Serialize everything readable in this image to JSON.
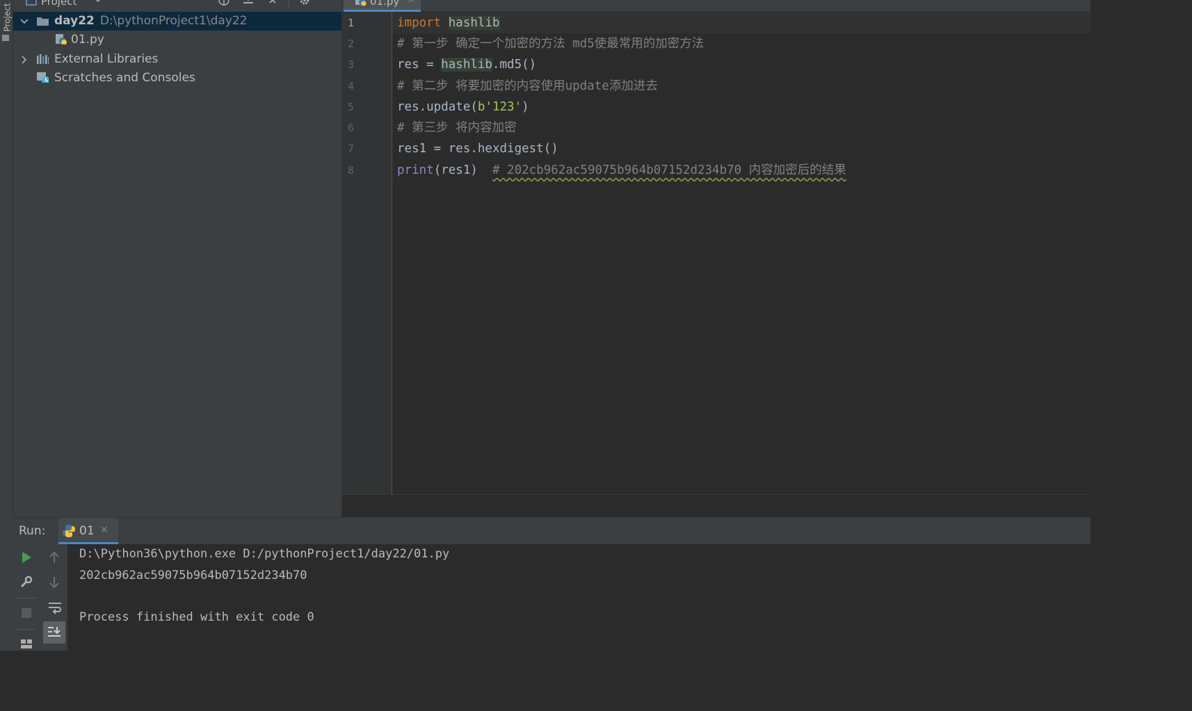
{
  "left_strip": {
    "label": "Project"
  },
  "project_panel": {
    "title": "Project",
    "tree": [
      {
        "label": "day22",
        "path": "D:\\pythonProject1\\day22",
        "expanded": true,
        "selected": true,
        "icon": "folder-icon"
      },
      {
        "label": "01.py",
        "icon": "python-file-icon"
      },
      {
        "label": "External Libraries",
        "expanded": false,
        "icon": "libraries-icon"
      },
      {
        "label": "Scratches and Consoles",
        "icon": "scratches-icon"
      }
    ]
  },
  "editor": {
    "tab_label": "01.py",
    "line_numbers": [
      "1",
      "2",
      "3",
      "4",
      "5",
      "6",
      "7",
      "8"
    ],
    "lines": [
      {
        "t1": "import",
        "t2": " ",
        "t3": "hashlib"
      },
      {
        "t1": "# 第一步 确定一个加密的方法 md5使最常用的加密方法"
      },
      {
        "t1": "res = ",
        "t2": "hashlib",
        "t3": ".md5()"
      },
      {
        "t1": "# 第二步 将要加密的内容使用update添加进去"
      },
      {
        "t1": "res.update(",
        "t2": "b'123'",
        "t3": ")"
      },
      {
        "t1": "# 第三步 将内容加密"
      },
      {
        "t1": "res1 = res.hexdigest()"
      },
      {
        "t1": "print",
        "t2": "(res1)  ",
        "t3": "# 202cb962ac59075b964b07152d234b70 内容加密后的结果"
      }
    ]
  },
  "run_panel": {
    "label": "Run:",
    "tab_label": "01",
    "output": [
      "D:\\Python36\\python.exe D:/pythonProject1/day22/01.py",
      "202cb962ac59075b964b07152d234b70",
      "",
      "Process finished with exit code 0"
    ]
  },
  "colors": {
    "keyword": "#cc7832",
    "comment": "#808080",
    "string": "#a5c25c",
    "builtin": "#8888c6",
    "selection": "#0d293e",
    "accent": "#4a88c7",
    "run_green": "#499c54"
  }
}
